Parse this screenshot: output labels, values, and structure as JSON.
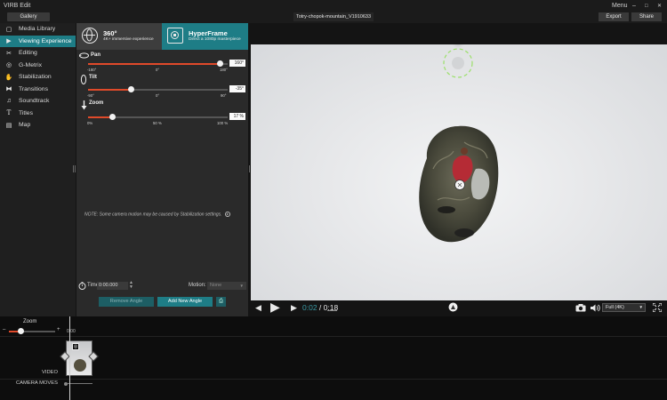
{
  "app": {
    "title": "VIRB Edit",
    "menu_label": "Menu",
    "minimize": "–",
    "maximize": "□",
    "close": "✕"
  },
  "topbar": {
    "gallery_label": "Gallery",
    "filename": "Totry-chopok-mountain_V1910633",
    "export_label": "Export",
    "share_label": "Share"
  },
  "sidebar": {
    "items": [
      {
        "label": "Media Library",
        "icon": "media-library-icon",
        "glyph": "▢",
        "active": false
      },
      {
        "label": "Viewing Experience",
        "icon": "viewing-experience-icon",
        "glyph": "▶",
        "active": true
      },
      {
        "label": "Editing",
        "icon": "scissors-icon",
        "glyph": "✂",
        "active": false
      },
      {
        "label": "G-Metrix",
        "icon": "gmetrix-icon",
        "glyph": "◎",
        "active": false
      },
      {
        "label": "Stabilization",
        "icon": "stabilization-icon",
        "glyph": "✋",
        "active": false
      },
      {
        "label": "Transitions",
        "icon": "transitions-icon",
        "glyph": "⧓",
        "active": false
      },
      {
        "label": "Soundtrack",
        "icon": "music-note-icon",
        "glyph": "♫",
        "active": false
      },
      {
        "label": "Titles",
        "icon": "titles-icon",
        "glyph": "T",
        "active": false
      },
      {
        "label": "Map",
        "icon": "map-icon",
        "glyph": "▤",
        "active": false
      }
    ]
  },
  "panel": {
    "tab360": {
      "title": "360°",
      "subtitle": "4K+ immersive experience"
    },
    "tab_hyperframe": {
      "title": "HyperFrame",
      "subtitle": "Direct a 1080p masterpiece"
    },
    "pan": {
      "label": "Pan",
      "value": "160°",
      "ticks": [
        "-180°",
        "0°",
        "180°"
      ],
      "fraction": 0.944
    },
    "tilt": {
      "label": "Tilt",
      "value": "-35°",
      "ticks": [
        "-90°",
        "0°",
        "90°"
      ],
      "fraction": 0.306
    },
    "zoom": {
      "label": "Zoom",
      "value": "17 %",
      "ticks": [
        "0%",
        "50 %",
        "100 %"
      ],
      "fraction": 0.17
    },
    "note": "NOTE: Some camera motion may be caused by Stabilization settings.",
    "time_label": "Time",
    "time_value": "0:00.000",
    "motion_label": "Motion:",
    "motion_value": "None",
    "remove_angle_label": "Remove Angle",
    "add_angle_label": "Add New Angle"
  },
  "player": {
    "current_time": "0:02",
    "separator": " / ",
    "total_time": "0:18",
    "quality": "Full (4K)"
  },
  "timeline": {
    "zoom_label": "Zoom",
    "zoom_fraction": 0.25,
    "time_marker": "0:00",
    "video_label": "VIDEO",
    "camera_moves_label": "CAMERA MOVES"
  },
  "colors": {
    "accent": "#1e7d86",
    "slider_fill": "#e04a2a",
    "current_time": "#3a9aa4"
  }
}
